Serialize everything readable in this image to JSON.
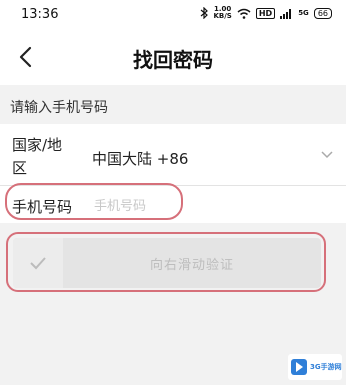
{
  "status_bar": {
    "time": "13:36",
    "net_speed_value": "1.00",
    "net_speed_unit": "KB/S",
    "hd_tag": "HD",
    "signal_text": "5G",
    "battery": "66"
  },
  "header": {
    "title": "找回密码"
  },
  "form": {
    "section_label": "请输入手机号码",
    "country_label": "国家/地区",
    "country_value": "中国大陆 +86",
    "phone_label": "手机号码",
    "phone_placeholder": "手机号码"
  },
  "slider": {
    "text": "向右滑动验证"
  },
  "watermark": {
    "text": "3G手游网"
  },
  "colors": {
    "highlight": "#d6707a",
    "background": "#f2f2f2",
    "watermark": "#2f7fd8"
  }
}
